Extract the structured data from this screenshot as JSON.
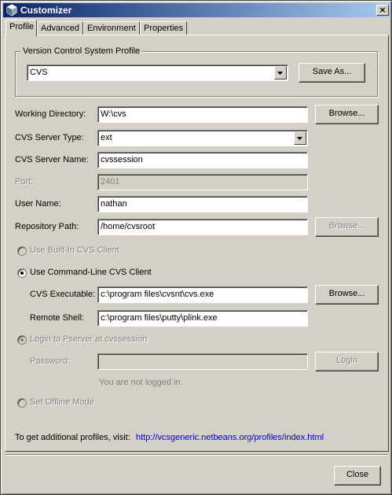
{
  "window": {
    "title": "Customizer",
    "close_glyph": "×",
    "icon": "netbeans-cube-icon"
  },
  "tabs": [
    {
      "label": "Profile",
      "active": true
    },
    {
      "label": "Advanced",
      "active": false
    },
    {
      "label": "Environment",
      "active": false
    },
    {
      "label": "Properties",
      "active": false
    }
  ],
  "profile_group": {
    "title": "Version Control System Profile",
    "selected_profile": "CVS",
    "save_as_label": "Save As..."
  },
  "fields": {
    "working_directory": {
      "label": "Working Directory:",
      "value": "W:\\cvs",
      "browse_label": "Browse..."
    },
    "server_type": {
      "label": "CVS Server Type:",
      "value": "ext"
    },
    "server_name": {
      "label": "CVS Server Name:",
      "value": "cvssession"
    },
    "port": {
      "label": "Port:",
      "value": "2401"
    },
    "user_name": {
      "label": "User Name:",
      "value": "nathan"
    },
    "repository_path": {
      "label": "Repository Path:",
      "value": "/home/cvsroot",
      "browse_label": "Browse..."
    }
  },
  "client_options": {
    "builtin": {
      "label": "Use Built-In CVS Client",
      "selected": false,
      "enabled": false
    },
    "command_line": {
      "label": "Use Command-Line CVS Client",
      "selected": true,
      "enabled": true
    },
    "executable": {
      "label": "CVS Executable:",
      "value": "c:\\program files\\cvsnt\\cvs.exe",
      "browse_label": "Browse..."
    },
    "remote_shell": {
      "label": "Remote Shell:",
      "value": "c:\\program files\\putty\\plink.exe"
    }
  },
  "pserver": {
    "login_label": "Login to Pserver at cvssession",
    "password_label": "Password:",
    "password_value": "",
    "login_button": "Login",
    "status": "You are not logged in."
  },
  "offline": {
    "label": "Set Offline Mode"
  },
  "footer": {
    "text": "To get additional profiles, visit:",
    "link": "http://vcsgeneric.netbeans.org/profiles/index.html",
    "close_label": "Close"
  },
  "colors": {
    "link": "#0000ee",
    "titlebar_start": "#0a246a",
    "titlebar_end": "#a6caf0",
    "face": "#d4d0c8"
  }
}
